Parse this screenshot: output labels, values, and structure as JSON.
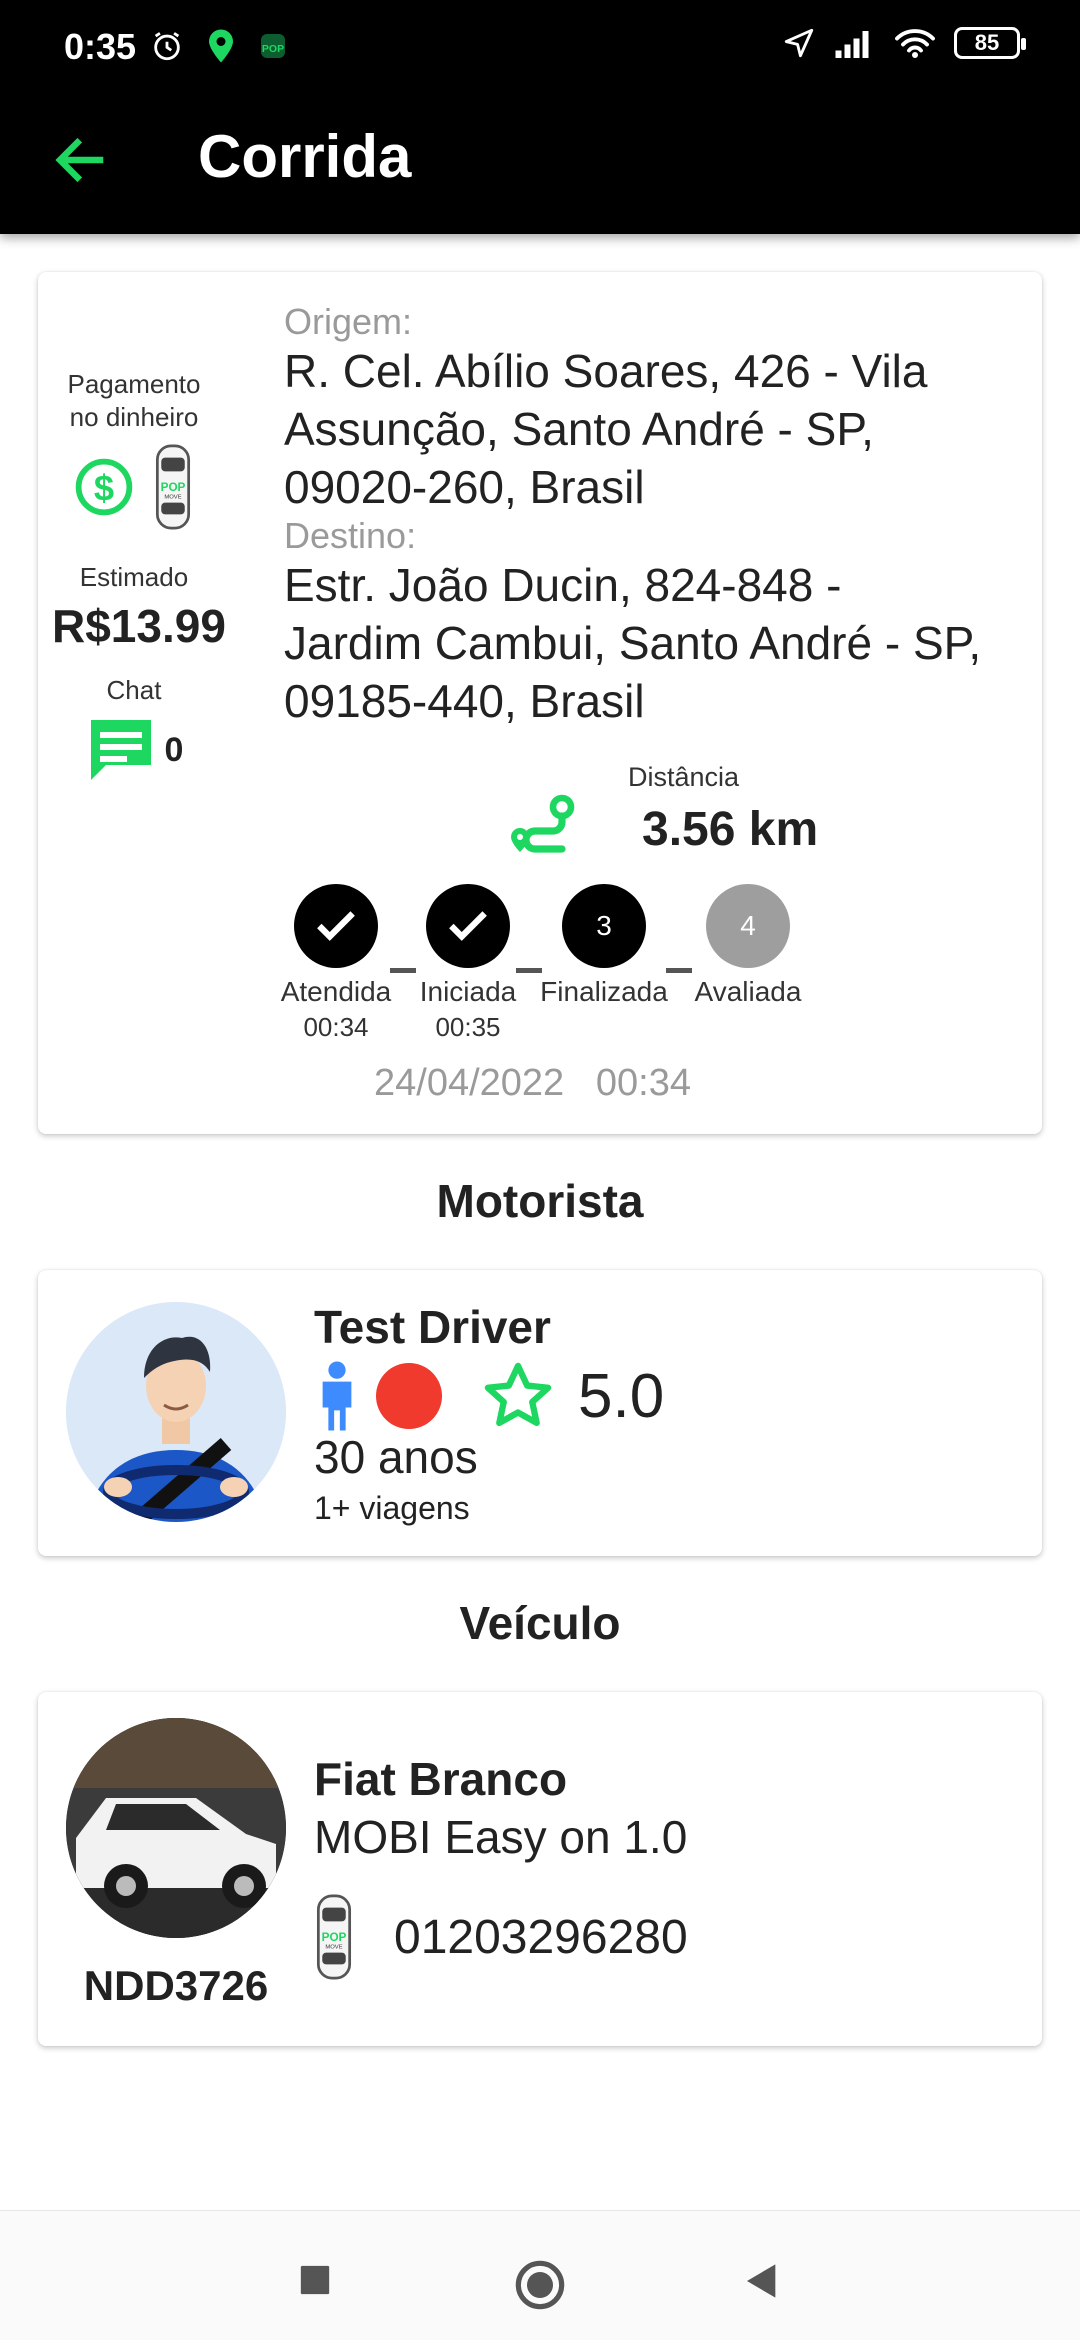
{
  "status_bar": {
    "time": "0:35",
    "battery": "85",
    "icons": [
      "alarm-icon",
      "pop-app-icon",
      "pop-move-icon",
      "location-arrow-icon",
      "signal-icon",
      "wifi-icon",
      "battery-icon"
    ]
  },
  "app_bar": {
    "title": "Corrida",
    "back_icon": "arrow-left-icon"
  },
  "ride": {
    "payment_label": "Pagamento no dinheiro",
    "estimate_label": "Estimado",
    "estimate_value": "R$13.99",
    "chat_label": "Chat",
    "chat_count": "0",
    "origin_label": "Origem:",
    "origin_line1": "R. Cel. Abílio Soares, 426 - Vila",
    "origin_line2": "Assunção, Santo André - SP,",
    "origin_line3": "09020-260, Brasil",
    "dest_label": "Destino:",
    "dest_line1": "Estr. João Ducin, 824-848 -",
    "dest_line2": "Jardim Cambui, Santo André - SP,",
    "dest_line3": "09185-440, Brasil",
    "distance_label": "Distância",
    "distance_value": "3.56 km",
    "steps": [
      {
        "label": "Atendida",
        "time": "00:34",
        "mark": "✓",
        "state": "done"
      },
      {
        "label": "Iniciada",
        "time": "00:35",
        "mark": "✓",
        "state": "done"
      },
      {
        "label": "Finalizada",
        "time": "",
        "mark": "3",
        "state": "current"
      },
      {
        "label": "Avaliada",
        "time": "",
        "mark": "4",
        "state": "pending"
      }
    ],
    "date": "24/04/2022",
    "time": "00:34"
  },
  "driver_section_title": "Motorista",
  "driver": {
    "name": "Test Driver",
    "rating": "5.0",
    "age": "30 anos",
    "trips": "1+ viagens"
  },
  "vehicle_section_title": "Veículo",
  "vehicle": {
    "brand_color": "Fiat Branco",
    "model": "MOBI Easy on 1.0",
    "plate": "NDD3726",
    "code": "01203296280"
  },
  "colors": {
    "accent": "#1ed760",
    "bar": "#000000",
    "pending": "#9e9e9e",
    "gender_icon": "#3d8bfd",
    "status_dot": "#f03a2e"
  }
}
